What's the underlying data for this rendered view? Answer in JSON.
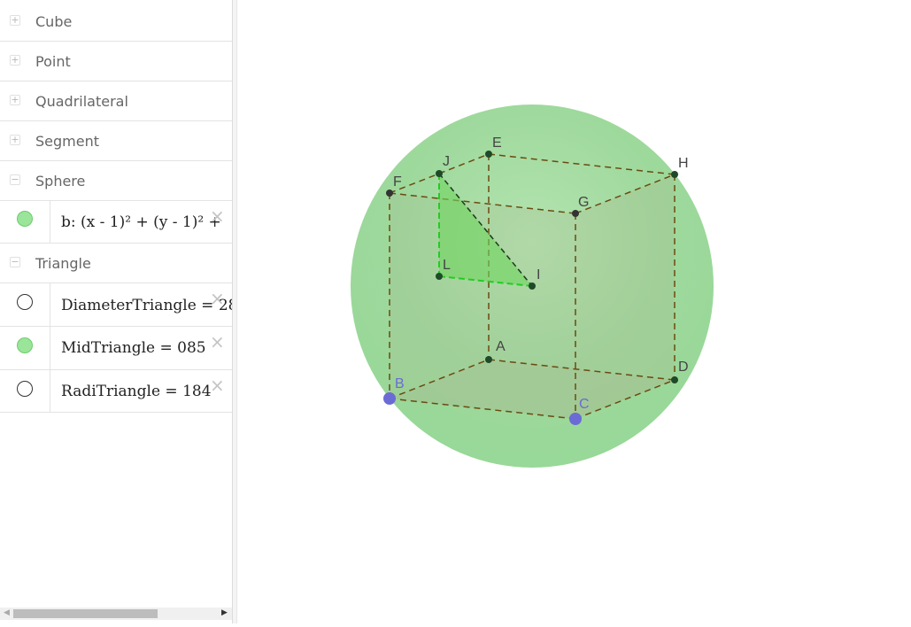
{
  "algebra": {
    "groups": [
      {
        "label": "Cube",
        "state": "+"
      },
      {
        "label": "Point",
        "state": "+"
      },
      {
        "label": "Quadrilateral",
        "state": "+"
      },
      {
        "label": "Segment",
        "state": "+"
      },
      {
        "label": "Sphere",
        "state": "−"
      },
      {
        "label": "Triangle",
        "state": "−"
      }
    ],
    "sphere_items": [
      {
        "text": "b: (x - 1)² + (y - 1)² +",
        "visible": true
      }
    ],
    "triangle_items": [
      {
        "text": "DiameterTriangle = 28",
        "visible": false
      },
      {
        "text": "MidTriangle = 085",
        "visible": true
      },
      {
        "text": "RadiTriangle = 184",
        "visible": false
      }
    ],
    "delete_glyph": "×",
    "scroll": {
      "left_arrow": "◀",
      "right_arrow": "▶"
    }
  },
  "graphics": {
    "points": [
      {
        "name": "A",
        "color": "#1e4a2a"
      },
      {
        "name": "B",
        "color": "#6b6bd6"
      },
      {
        "name": "C",
        "color": "#6b6bd6"
      },
      {
        "name": "D",
        "color": "#1e4a2a"
      },
      {
        "name": "E",
        "color": "#1e4a2a"
      },
      {
        "name": "F",
        "color": "#333333"
      },
      {
        "name": "G",
        "color": "#333333"
      },
      {
        "name": "H",
        "color": "#1e4a2a"
      },
      {
        "name": "I",
        "color": "#1e4a2a"
      },
      {
        "name": "J",
        "color": "#1e4a2a"
      },
      {
        "name": "L",
        "color": "#1e4a2a"
      }
    ],
    "colors": {
      "sphere": "#9ad89a",
      "edge": "#6b4a10",
      "triangle": "#7ad86a",
      "triangle_edge": "#22cc22"
    }
  }
}
